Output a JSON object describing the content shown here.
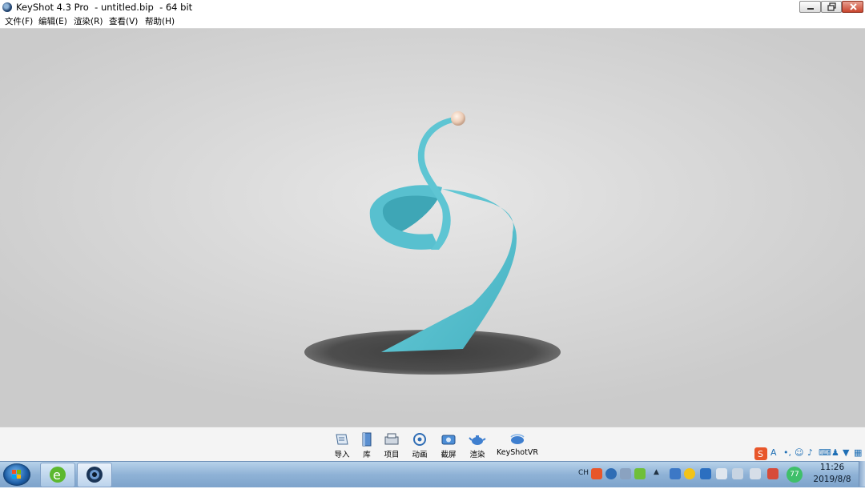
{
  "window": {
    "title": "KeyShot 4.3 Pro  - untitled.bip  - 64 bit"
  },
  "menu": [
    {
      "label": "文件(F)"
    },
    {
      "label": "编辑(E)"
    },
    {
      "label": "渲染(R)"
    },
    {
      "label": "查看(V)"
    },
    {
      "label": "帮助(H)"
    }
  ],
  "toolbar": [
    {
      "label": "导入",
      "icon": "import-icon"
    },
    {
      "label": "库",
      "icon": "library-icon"
    },
    {
      "label": "项目",
      "icon": "project-icon"
    },
    {
      "label": "动画",
      "icon": "animation-icon"
    },
    {
      "label": "截屏",
      "icon": "screenshot-icon"
    },
    {
      "label": "渲染",
      "icon": "render-teapot-icon"
    },
    {
      "label": "KeyShotVR",
      "icon": "keyshotvr-icon"
    }
  ],
  "ime_bar": {
    "letter": "A"
  },
  "taskbar": {
    "tray_language": "CH",
    "tray_badge": "77",
    "clock_time": "11:26",
    "clock_date": "2019/8/8"
  },
  "colors": {
    "ribbon": "#5ec5d3",
    "ribbon_dark": "#3a9fb0",
    "shadow_disc": "#4a4a4a",
    "sphere": "#f1d9c8"
  }
}
